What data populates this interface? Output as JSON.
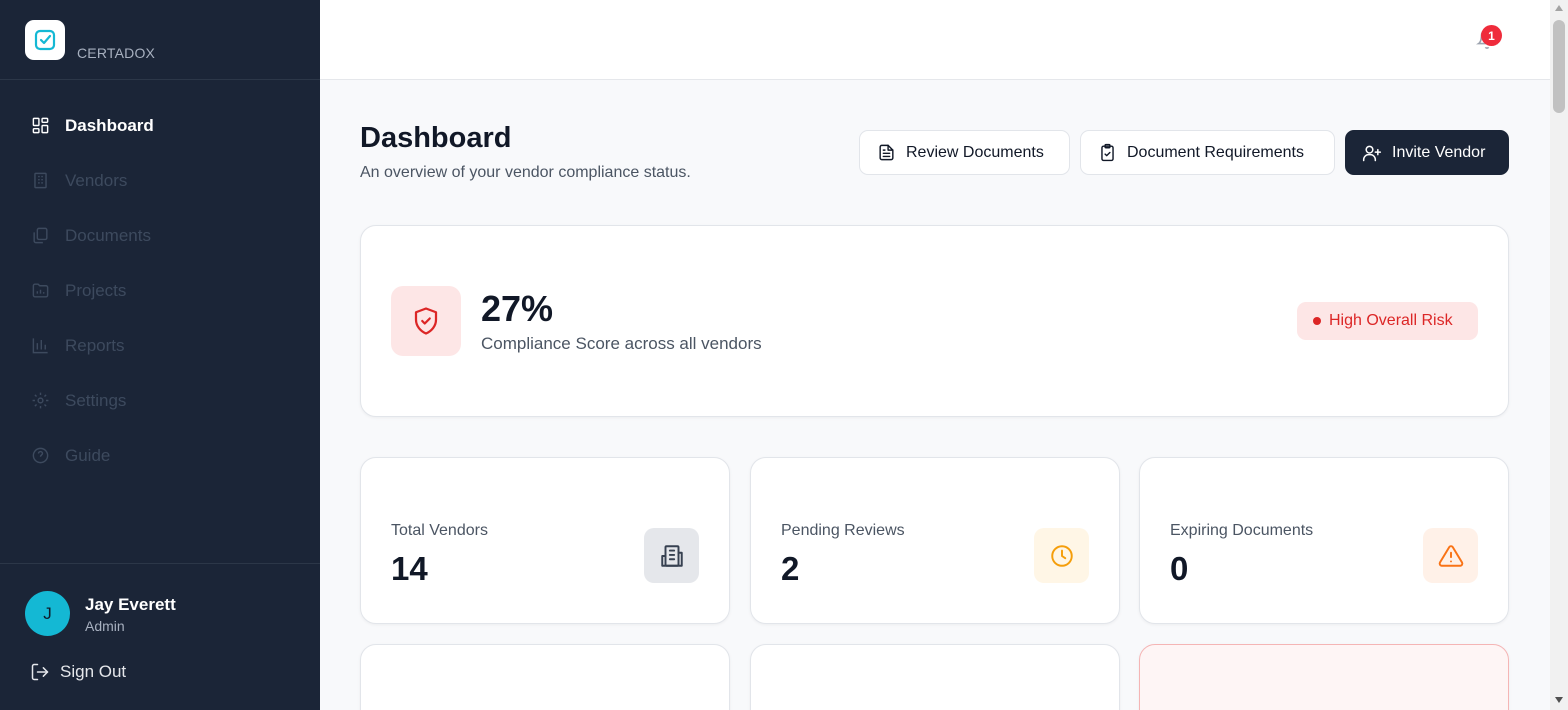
{
  "brand": {
    "name": "CERTADOX",
    "logo_icon": "check-square-icon"
  },
  "sidebar": {
    "items": [
      {
        "label": "Dashboard",
        "icon": "grid-icon",
        "active": true
      },
      {
        "label": "Vendors",
        "icon": "building-icon",
        "active": false
      },
      {
        "label": "Documents",
        "icon": "documents-icon",
        "active": false
      },
      {
        "label": "Projects",
        "icon": "folder-chart-icon",
        "active": false
      },
      {
        "label": "Reports",
        "icon": "bar-chart-icon",
        "active": false
      },
      {
        "label": "Settings",
        "icon": "gear-icon",
        "active": false
      },
      {
        "label": "Guide",
        "icon": "help-circle-icon",
        "active": false
      }
    ],
    "user": {
      "initial": "J",
      "name": "Jay Everett",
      "role": "Admin"
    },
    "signout_label": "Sign Out"
  },
  "topbar": {
    "notification_count": "1"
  },
  "header": {
    "title": "Dashboard",
    "subtitle": "An overview of your vendor compliance status.",
    "buttons": {
      "review": "Review Documents",
      "requirements": "Document Requirements",
      "invite": "Invite Vendor"
    }
  },
  "score": {
    "value": "27%",
    "label": "Compliance Score across all vendors",
    "risk": "High Overall Risk"
  },
  "stats": [
    {
      "label": "Total Vendors",
      "value": "14",
      "icon": "building-icon"
    },
    {
      "label": "Pending Reviews",
      "value": "2",
      "icon": "clock-icon"
    },
    {
      "label": "Expiring Documents",
      "value": "0",
      "icon": "warning-icon"
    }
  ],
  "colors": {
    "sidebar_bg": "#1b2537",
    "accent_cyan": "#14b8d4",
    "risk_red": "#dc2626",
    "pending_amber": "#f59e0b",
    "warning_orange": "#f97316"
  }
}
